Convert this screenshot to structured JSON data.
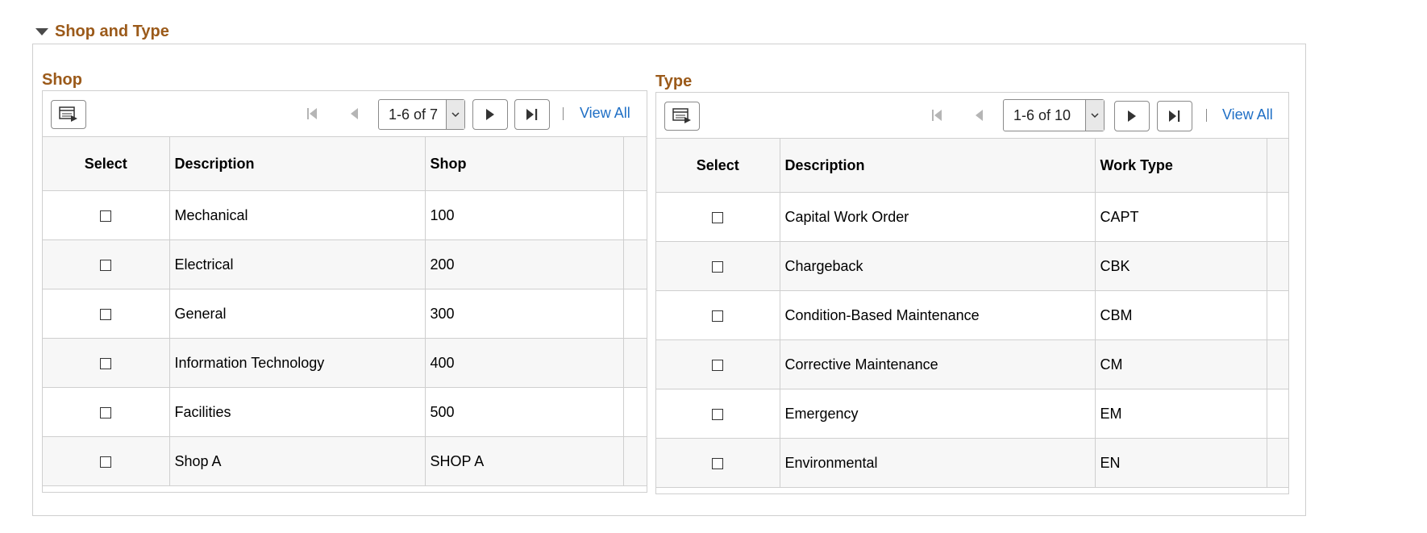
{
  "section": {
    "title": "Shop and Type"
  },
  "shop_grid": {
    "title": "Shop",
    "pager_text": "1-6 of 7",
    "view_all": "View All",
    "columns": [
      "Select",
      "Description",
      "Shop"
    ],
    "rows": [
      {
        "description": "Mechanical",
        "code": "100",
        "checked": false
      },
      {
        "description": "Electrical",
        "code": "200",
        "checked": false
      },
      {
        "description": "General",
        "code": "300",
        "checked": false
      },
      {
        "description": "Information Technology",
        "code": "400",
        "checked": false
      },
      {
        "description": "Facilities",
        "code": "500",
        "checked": false
      },
      {
        "description": "Shop A",
        "code": "SHOP A",
        "checked": false
      }
    ]
  },
  "type_grid": {
    "title": "Type",
    "pager_text": "1-6 of 10",
    "view_all": "View All",
    "columns": [
      "Select",
      "Description",
      "Work Type"
    ],
    "rows": [
      {
        "description": "Capital Work Order",
        "code": "CAPT",
        "checked": false
      },
      {
        "description": "Chargeback",
        "code": "CBK",
        "checked": false
      },
      {
        "description": "Condition-Based Maintenance",
        "code": "CBM",
        "checked": false
      },
      {
        "description": "Corrective Maintenance",
        "code": "CM",
        "checked": false
      },
      {
        "description": "Emergency",
        "code": "EM",
        "checked": false
      },
      {
        "description": "Environmental",
        "code": "EN",
        "checked": false
      }
    ]
  },
  "colors": {
    "title": "#9b5a1a",
    "link": "#1f6fc5",
    "border": "#cfcfcf",
    "row_alt": "#f7f7f7"
  },
  "icons": [
    "collapse-triangle-icon",
    "personalize-grid-icon",
    "first-page-icon",
    "previous-page-icon",
    "chevron-down-icon",
    "next-page-icon",
    "last-page-icon"
  ]
}
